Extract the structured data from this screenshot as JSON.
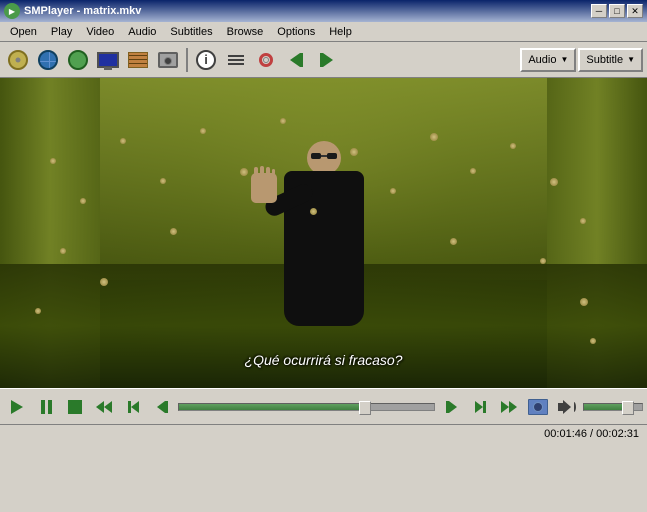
{
  "window": {
    "title": "SMPlayer - matrix.mkv",
    "icon": "▶"
  },
  "title_controls": {
    "minimize": "─",
    "maximize": "□",
    "close": "✕"
  },
  "menu": {
    "items": [
      "Open",
      "Play",
      "Video",
      "Audio",
      "Subtitles",
      "Browse",
      "Options",
      "Help"
    ]
  },
  "toolbar": {
    "audio_label": "Audio",
    "subtitle_label": "Subtitle",
    "arrow": "▼"
  },
  "video": {
    "subtitle": "¿Qué ocurrirá si fracaso?"
  },
  "controls": {
    "play_title": "Play",
    "pause_title": "Pause",
    "stop_title": "Stop",
    "rewind_title": "Rewind",
    "forward_title": "Forward",
    "prev_title": "Previous",
    "next_title": "Next",
    "slow_title": "Slow",
    "fast_title": "Fast",
    "volume_icon": "🔊",
    "screenshot_icon": "📷"
  },
  "status": {
    "time_current": "00:01:46",
    "time_separator": " / ",
    "time_total": "00:02:31"
  },
  "progress": {
    "fill_percent": 73,
    "thumb_percent": 73
  },
  "volume": {
    "fill_percent": 75,
    "thumb_percent": 75
  }
}
